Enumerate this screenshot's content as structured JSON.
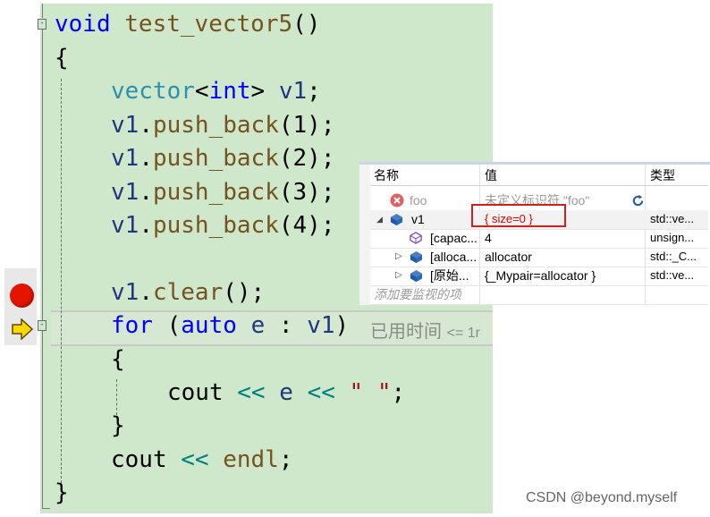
{
  "code": {
    "fn_return_type": "void",
    "fn_name": "test_vector5",
    "fn_parens": "()",
    "open_brace": "{",
    "decl_type": "vector",
    "decl_lt": "<",
    "decl_int": "int",
    "decl_gt": ">",
    "decl_var": "v1",
    "decl_semi": ";",
    "push_var": "v1",
    "push_dot": ".",
    "push_fn": "push_back",
    "push_args": [
      "(1);",
      "(2);",
      "(3);",
      "(4);"
    ],
    "clear_var": "v1",
    "clear_dot": ".",
    "clear_fn": "clear",
    "clear_tail": "();",
    "for_kw": "for",
    "for_open": " (",
    "for_auto": "auto",
    "for_e": "e",
    "for_colon": " : ",
    "for_v1": "v1",
    "for_close": ")",
    "inner_open": "{",
    "cout1": "cout",
    "op1": "<<",
    "e_var": "e",
    "op2": "<<",
    "space_str": "\" \"",
    "semi1": ";",
    "inner_close": "}",
    "cout2": "cout",
    "op3": "<<",
    "endl": "endl",
    "semi2": ";",
    "close_brace": "}",
    "elapsed_label": "已用时间",
    "elapsed_value": "<= 1r",
    "fold_toggle": "-"
  },
  "watch": {
    "headers": {
      "name": "名称",
      "value": "值",
      "type": "类型"
    },
    "rows": [
      {
        "name": "foo",
        "value": "未定义标识符 \"foo\"",
        "type": "",
        "icon": "error-icon"
      },
      {
        "name": "v1",
        "value": "{ size=0 }",
        "type": "std::ve...",
        "icon": "object-icon",
        "expander": "◢"
      },
      {
        "name": "[capac...",
        "value": "4",
        "type": "unsign...",
        "icon": "field-icon"
      },
      {
        "name": "[alloca...",
        "value": "allocator",
        "type": "std::_C...",
        "icon": "object-icon",
        "expander": "▷"
      },
      {
        "name": "[原始...",
        "value": "{_Mypair=allocator }",
        "type": "std::ve...",
        "icon": "object-icon",
        "expander": "▷"
      }
    ],
    "add_placeholder": "添加要监视的项",
    "highlight_color": "#d02020",
    "error_value_color": "#9a9a9a",
    "changed_value_color": "#e00000"
  },
  "watermark": "CSDN @beyond.myself",
  "colors": {
    "code_background": "#cfe8cb",
    "keyword": "#0000ff",
    "function": "#74531f",
    "type": "#2b91af",
    "variable": "#1f377f",
    "string": "#a31515"
  }
}
